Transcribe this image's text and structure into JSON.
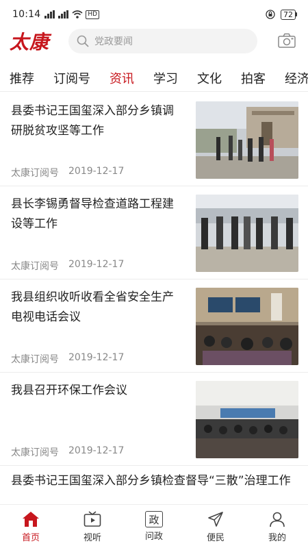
{
  "status_bar": {
    "time": "10:14",
    "network_label": "HD",
    "battery": "72"
  },
  "header": {
    "logo_text": "太康",
    "search_placeholder": "党政要闻",
    "accent_color": "#c7161d"
  },
  "tabs": [
    {
      "label": "推荐",
      "active": false
    },
    {
      "label": "订阅号",
      "active": false
    },
    {
      "label": "资讯",
      "active": true
    },
    {
      "label": "学习",
      "active": false
    },
    {
      "label": "文化",
      "active": false
    },
    {
      "label": "拍客",
      "active": false
    },
    {
      "label": "经济",
      "active": false
    }
  ],
  "news": [
    {
      "title": "县委书记王国玺深入部分乡镇调研脱贫攻坚等工作",
      "source": "太康订阅号",
      "date": "2019-12-17"
    },
    {
      "title": "县长李锡勇督导检查道路工程建设等工作",
      "source": "太康订阅号",
      "date": "2019-12-17"
    },
    {
      "title": "我县组织收听收看全省安全生产电视电话会议",
      "source": "太康订阅号",
      "date": "2019-12-17"
    },
    {
      "title": "我县召开环保工作会议",
      "source": "太康订阅号",
      "date": "2019-12-17"
    },
    {
      "title": "县委书记王国玺深入部分乡镇检查督导“三散”治理工作"
    }
  ],
  "bottom_nav": [
    {
      "label": "首页",
      "icon": "home-icon",
      "active": true
    },
    {
      "label": "视听",
      "icon": "tv-icon",
      "active": false
    },
    {
      "label": "问政",
      "icon": "zheng-icon",
      "icon_text": "政",
      "active": false
    },
    {
      "label": "便民",
      "icon": "send-icon",
      "active": false
    },
    {
      "label": "我的",
      "icon": "user-icon",
      "active": false
    }
  ]
}
